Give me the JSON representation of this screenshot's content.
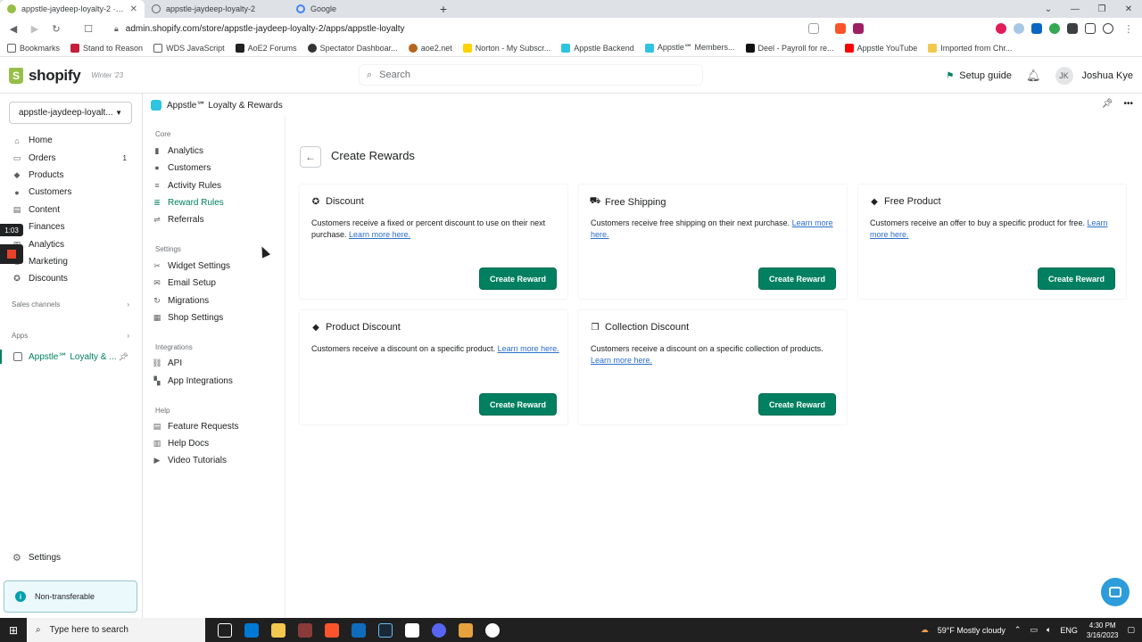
{
  "browser": {
    "tabs": [
      {
        "label": "appstle-jaydeep-loyalty-2 · Apps",
        "active": true
      },
      {
        "label": "appstle-jaydeep-loyalty-2",
        "active": false
      },
      {
        "label": "Google",
        "active": false
      }
    ],
    "new_tab": "+",
    "url": "admin.shopify.com/store/appstle-jaydeep-loyalty-2/apps/appstle-loyalty",
    "bookmarks": [
      "Bookmarks",
      "Stand to Reason",
      "WDS JavaScript",
      "AoE2 Forums",
      "Spectator Dashboar...",
      "aoe2.net",
      "Norton - My Subscr...",
      "Appstle Backend",
      "Appstle℠ Members...",
      "Deel - Payroll for re...",
      "Appstle YouTube",
      "Imported from Chr..."
    ]
  },
  "topbar": {
    "brand": "shopify",
    "edition": "Winter '23",
    "search_placeholder": "Search",
    "setup_guide": "Setup guide",
    "user_initials": "JK",
    "user_name": "Joshua Kye"
  },
  "sidebar": {
    "store": "appstle-jaydeep-loyalt...",
    "items": [
      {
        "label": "Home",
        "icon": "home-icon"
      },
      {
        "label": "Orders",
        "icon": "orders-icon",
        "count": "1"
      },
      {
        "label": "Products",
        "icon": "products-icon"
      },
      {
        "label": "Customers",
        "icon": "customers-icon"
      },
      {
        "label": "Content",
        "icon": "content-icon"
      },
      {
        "label": "Finances",
        "icon": "finances-icon"
      },
      {
        "label": "Analytics",
        "icon": "analytics-icon"
      },
      {
        "label": "Marketing",
        "icon": "marketing-icon"
      },
      {
        "label": "Discounts",
        "icon": "discounts-icon"
      }
    ],
    "sales_channels": "Sales channels",
    "apps": "Apps",
    "active_app": "Appstle℠ Loyalty & ...",
    "settings": "Settings",
    "notice": "Non-transferable"
  },
  "recording": {
    "time": "1:03"
  },
  "appbar": {
    "title": "Appstle℠ Loyalty & Rewards"
  },
  "appnav": {
    "core_label": "Core",
    "core": [
      "Analytics",
      "Customers",
      "Activity Rules",
      "Reward Rules",
      "Referrals"
    ],
    "settings_label": "Settings",
    "settings": [
      "Widget Settings",
      "Email Setup",
      "Migrations",
      "Shop Settings"
    ],
    "integrations_label": "Integrations",
    "integrations": [
      "API",
      "App Integrations"
    ],
    "help_label": "Help",
    "help": [
      "Feature Requests",
      "Help Docs",
      "Video Tutorials"
    ]
  },
  "main": {
    "title": "Create Rewards",
    "cards": [
      {
        "title": "Discount",
        "desc": "Customers receive a fixed or percent discount to use on their next purchase.",
        "learn": "Learn more here.",
        "button": "Create Reward"
      },
      {
        "title": "Free Shipping",
        "desc": "Customers receive free shipping on their next purchase.",
        "learn": "Learn more here.",
        "button": "Create Reward"
      },
      {
        "title": "Free Product",
        "desc": "Customers receive an offer to buy a specific product for free.",
        "learn": "Learn more here.",
        "button": "Create Reward"
      },
      {
        "title": "Product Discount",
        "desc": "Customers receive a discount on a specific product.",
        "learn": "Learn more here.",
        "button": "Create Reward"
      },
      {
        "title": "Collection Discount",
        "desc": "Customers receive a discount on a specific collection of products.",
        "learn": "Learn more here.",
        "button": "Create Reward"
      }
    ]
  },
  "taskbar": {
    "search_placeholder": "Type here to search",
    "weather": "59°F  Mostly cloudy",
    "lang": "ENG",
    "time": "4:30 PM",
    "date": "3/16/2023"
  },
  "colors": {
    "accent": "#008060",
    "link": "#2c6ecb"
  }
}
